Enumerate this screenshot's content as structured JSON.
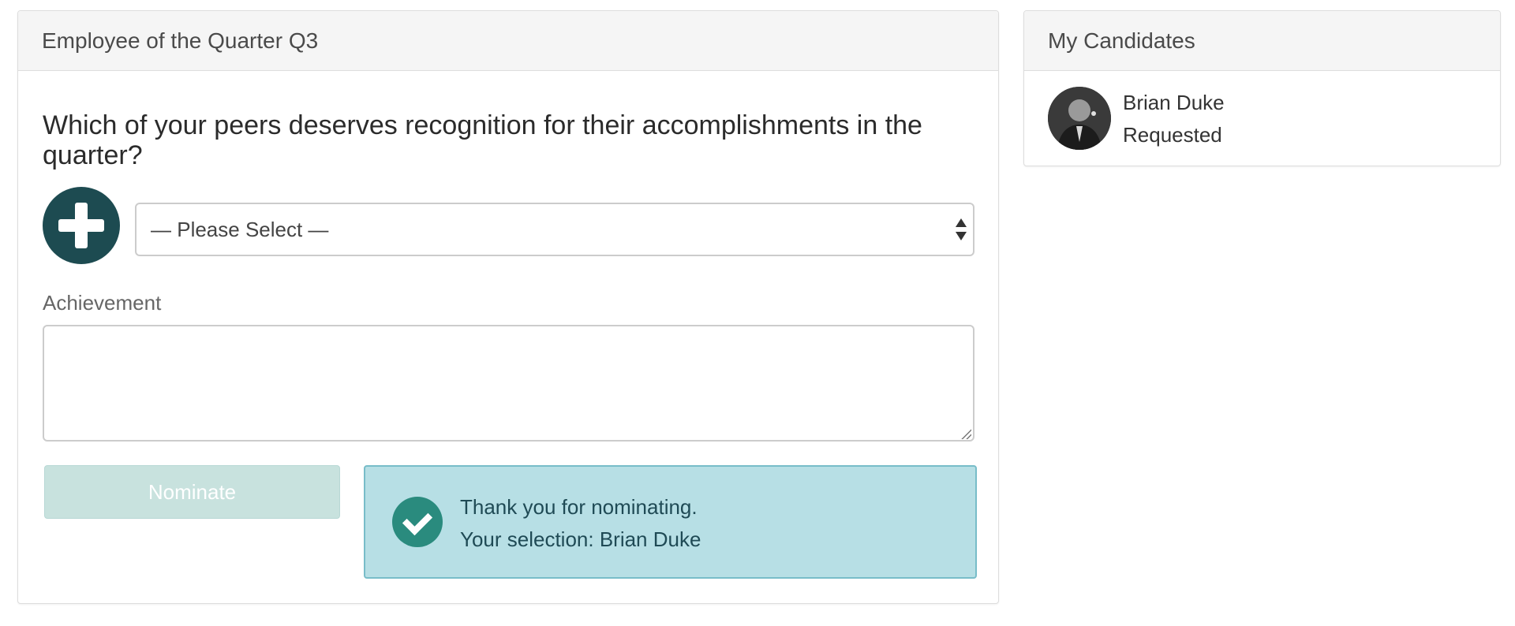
{
  "main_panel": {
    "title": "Employee of the Quarter Q3",
    "question": "Which of your peers deserves recognition for their accomplishments in the quarter?",
    "add_icon": "plus-circle-icon",
    "select": {
      "value": "— Please Select —"
    },
    "achievement": {
      "label": "Achievement",
      "value": ""
    },
    "nominate_label": "Nominate",
    "alert": {
      "icon": "check-circle-icon",
      "line1": "Thank you for nominating.",
      "line2": "Your selection: Brian Duke"
    }
  },
  "side_panel": {
    "title": "My Candidates",
    "candidates": [
      {
        "name": "Brian Duke",
        "status": "Requested"
      }
    ]
  },
  "colors": {
    "header_bg": "#f5f5f5",
    "add_button": "#1d4b51",
    "nominate_disabled": "#c8e2de",
    "alert_bg": "#b7dfe5",
    "alert_border": "#78bdc9",
    "check_icon": "#2a8b7e"
  }
}
